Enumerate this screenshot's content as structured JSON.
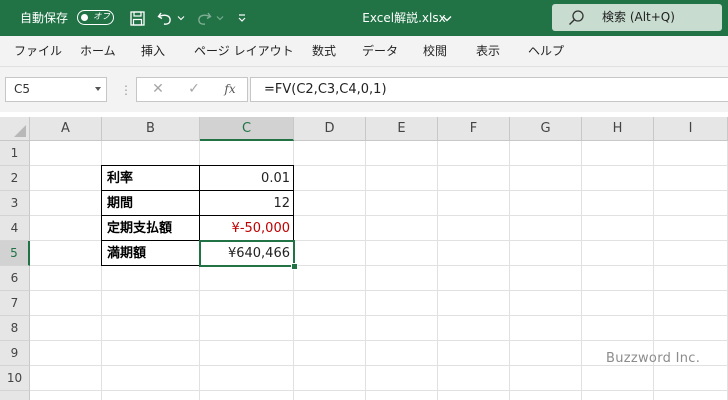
{
  "titlebar": {
    "autosave_label": "自動保存",
    "autosave_state": "オフ",
    "filename": "Excel解説.xlsx",
    "search_text": "検索 (Alt+Q)",
    "accent_color": "#217346"
  },
  "menu": {
    "items": [
      "ファイル",
      "ホーム",
      "挿入",
      "ページ レイアウト",
      "数式",
      "データ",
      "校閲",
      "表示",
      "ヘルプ"
    ]
  },
  "formula_bar": {
    "name_box": "C5",
    "fx_label": "fx",
    "formula": "=FV(C2,C3,C4,0,1)"
  },
  "sheet": {
    "columns": [
      "A",
      "B",
      "C",
      "D",
      "E",
      "F",
      "G",
      "H",
      "I"
    ],
    "rows": [
      "1",
      "2",
      "3",
      "4",
      "5",
      "6",
      "7",
      "8",
      "9",
      "10"
    ],
    "active_cell": "C5",
    "table": [
      {
        "label": "利率",
        "value": "0.01",
        "value_color": "#222222"
      },
      {
        "label": "期間",
        "value": "12",
        "value_color": "#222222"
      },
      {
        "label": "定期支払額",
        "value": "¥-50,000",
        "value_color": "#c00000"
      },
      {
        "label": "満期額",
        "value": "¥640,466",
        "value_color": "#222222"
      }
    ]
  },
  "watermark": "Buzzword Inc."
}
